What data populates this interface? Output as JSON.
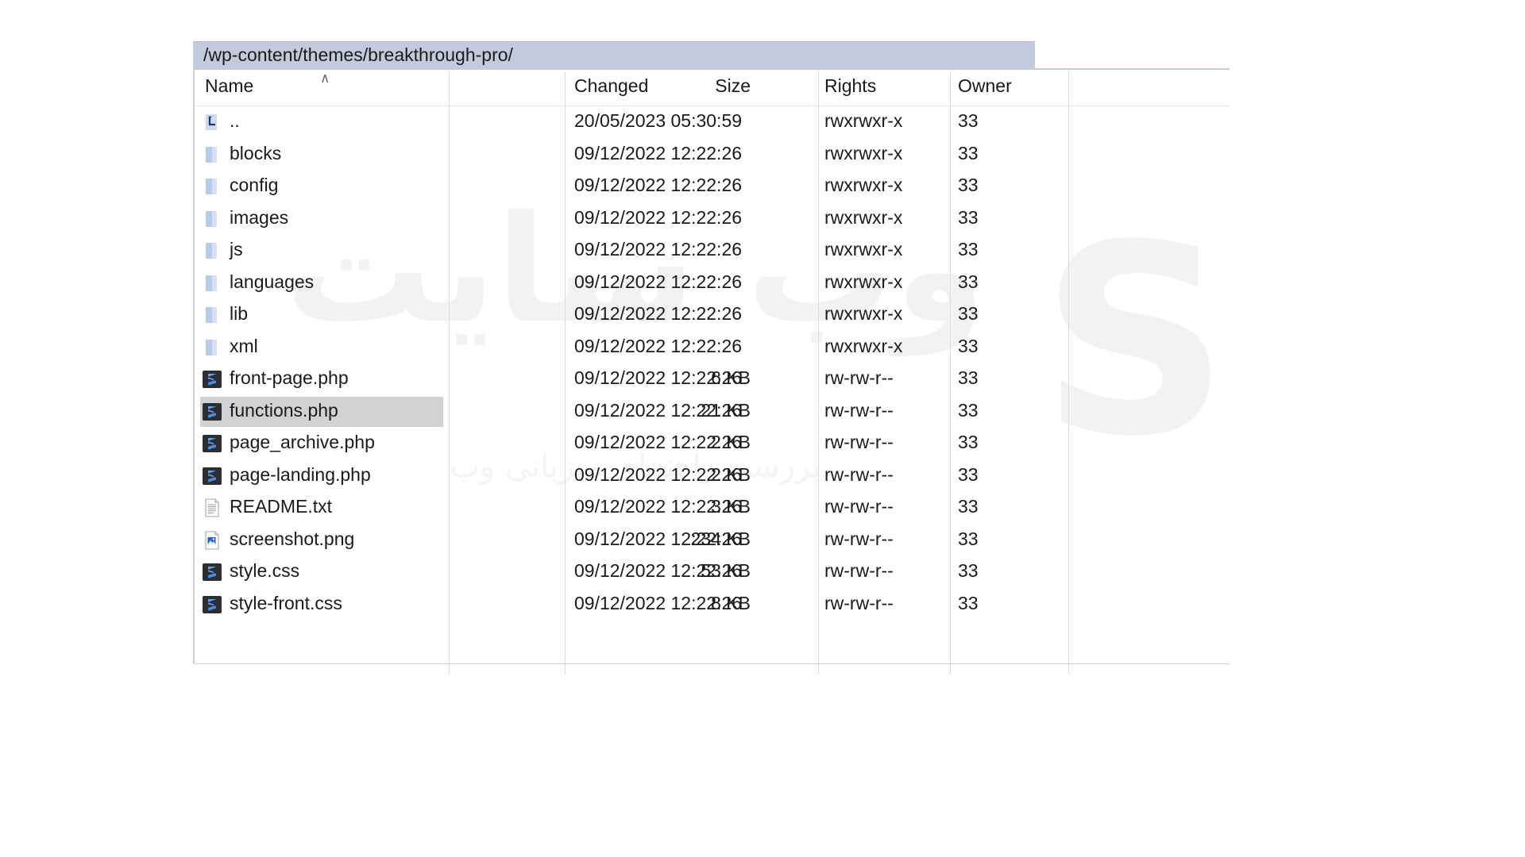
{
  "pathbar": {
    "path": "/wp-content/themes/breakthrough-pro/"
  },
  "columns": {
    "name": "Name",
    "size": "Size",
    "changed": "Changed",
    "rights": "Rights",
    "owner": "Owner",
    "sort_indicator": "∧"
  },
  "watermark": {
    "main": "وب سایت",
    "sub": "بررسی راهنمای میزبانی وب",
    "glyph": "S"
  },
  "rows": [
    {
      "icon": "parent-folder-icon",
      "name": "..",
      "size": "",
      "changed": "20/05/2023 05:30:59",
      "rights": "rwxrwxr-x",
      "owner": "33",
      "selected": false
    },
    {
      "icon": "folder-icon",
      "name": "blocks",
      "size": "",
      "changed": "09/12/2022 12:22:26",
      "rights": "rwxrwxr-x",
      "owner": "33",
      "selected": false
    },
    {
      "icon": "folder-icon",
      "name": "config",
      "size": "",
      "changed": "09/12/2022 12:22:26",
      "rights": "rwxrwxr-x",
      "owner": "33",
      "selected": false
    },
    {
      "icon": "folder-icon",
      "name": "images",
      "size": "",
      "changed": "09/12/2022 12:22:26",
      "rights": "rwxrwxr-x",
      "owner": "33",
      "selected": false
    },
    {
      "icon": "folder-icon",
      "name": "js",
      "size": "",
      "changed": "09/12/2022 12:22:26",
      "rights": "rwxrwxr-x",
      "owner": "33",
      "selected": false
    },
    {
      "icon": "folder-icon",
      "name": "languages",
      "size": "",
      "changed": "09/12/2022 12:22:26",
      "rights": "rwxrwxr-x",
      "owner": "33",
      "selected": false
    },
    {
      "icon": "folder-icon",
      "name": "lib",
      "size": "",
      "changed": "09/12/2022 12:22:26",
      "rights": "rwxrwxr-x",
      "owner": "33",
      "selected": false
    },
    {
      "icon": "folder-icon",
      "name": "xml",
      "size": "",
      "changed": "09/12/2022 12:22:26",
      "rights": "rwxrwxr-x",
      "owner": "33",
      "selected": false
    },
    {
      "icon": "sublime-file-icon",
      "name": "front-page.php",
      "size": "6 KB",
      "changed": "09/12/2022 12:22:26",
      "rights": "rw-rw-r--",
      "owner": "33",
      "selected": false
    },
    {
      "icon": "sublime-file-icon",
      "name": "functions.php",
      "size": "21 KB",
      "changed": "09/12/2022 12:22:26",
      "rights": "rw-rw-r--",
      "owner": "33",
      "selected": true
    },
    {
      "icon": "sublime-file-icon",
      "name": "page_archive.php",
      "size": "2 KB",
      "changed": "09/12/2022 12:22:26",
      "rights": "rw-rw-r--",
      "owner": "33",
      "selected": false
    },
    {
      "icon": "sublime-file-icon",
      "name": "page-landing.php",
      "size": "2 KB",
      "changed": "09/12/2022 12:22:26",
      "rights": "rw-rw-r--",
      "owner": "33",
      "selected": false
    },
    {
      "icon": "text-file-icon",
      "name": "README.txt",
      "size": "3 KB",
      "changed": "09/12/2022 12:22:26",
      "rights": "rw-rw-r--",
      "owner": "33",
      "selected": false
    },
    {
      "icon": "image-file-icon",
      "name": "screenshot.png",
      "size": "234 KB",
      "changed": "09/12/2022 12:22:26",
      "rights": "rw-rw-r--",
      "owner": "33",
      "selected": false
    },
    {
      "icon": "sublime-file-icon",
      "name": "style.css",
      "size": "53 KB",
      "changed": "09/12/2022 12:22:26",
      "rights": "rw-rw-r--",
      "owner": "33",
      "selected": false
    },
    {
      "icon": "sublime-file-icon",
      "name": "style-front.css",
      "size": "8 KB",
      "changed": "09/12/2022 12:22:26",
      "rights": "rw-rw-r--",
      "owner": "33",
      "selected": false
    }
  ],
  "colors": {
    "pathbar_bg": "#c3cadb",
    "selection_bg": "#d2d2d2",
    "folder_icon": "#c5d3ef",
    "sublime_icon_bg": "#2a2f34",
    "sublime_icon_glyph": "#4a86e8"
  }
}
